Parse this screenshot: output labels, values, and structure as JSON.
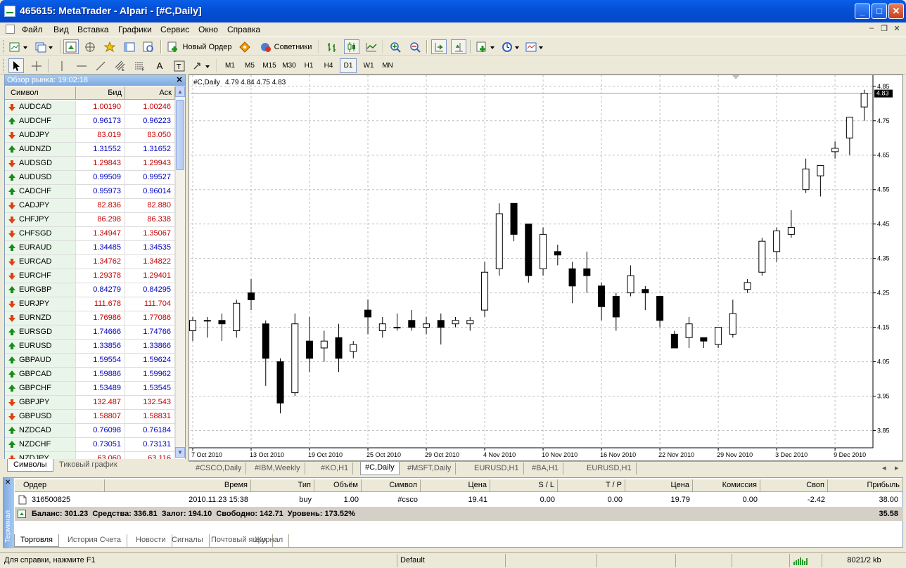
{
  "window": {
    "title": "465615: MetaTrader - Alpari - [#C,Daily]"
  },
  "menu": [
    "Файл",
    "Вид",
    "Вставка",
    "Графики",
    "Сервис",
    "Окно",
    "Справка"
  ],
  "toolbar": {
    "new_order": "Новый Ордер",
    "advisors": "Советники"
  },
  "timeframes": [
    "M1",
    "M5",
    "M15",
    "M30",
    "H1",
    "H4",
    "D1",
    "W1",
    "MN"
  ],
  "active_timeframe": "D1",
  "market_watch": {
    "title": "Обзор рынка: 19:02:18",
    "columns": {
      "symbol": "Символ",
      "bid": "Бид",
      "ask": "Аск"
    },
    "rows": [
      {
        "symbol": "AUDCAD",
        "bid": "1.00190",
        "ask": "1.00246",
        "dir": "down"
      },
      {
        "symbol": "AUDCHF",
        "bid": "0.96173",
        "ask": "0.96223",
        "dir": "up"
      },
      {
        "symbol": "AUDJPY",
        "bid": "83.019",
        "ask": "83.050",
        "dir": "down"
      },
      {
        "symbol": "AUDNZD",
        "bid": "1.31552",
        "ask": "1.31652",
        "dir": "up"
      },
      {
        "symbol": "AUDSGD",
        "bid": "1.29843",
        "ask": "1.29943",
        "dir": "down"
      },
      {
        "symbol": "AUDUSD",
        "bid": "0.99509",
        "ask": "0.99527",
        "dir": "up"
      },
      {
        "symbol": "CADCHF",
        "bid": "0.95973",
        "ask": "0.96014",
        "dir": "up"
      },
      {
        "symbol": "CADJPY",
        "bid": "82.836",
        "ask": "82.880",
        "dir": "down"
      },
      {
        "symbol": "CHFJPY",
        "bid": "86.298",
        "ask": "86.338",
        "dir": "down"
      },
      {
        "symbol": "CHFSGD",
        "bid": "1.34947",
        "ask": "1.35067",
        "dir": "down"
      },
      {
        "symbol": "EURAUD",
        "bid": "1.34485",
        "ask": "1.34535",
        "dir": "up"
      },
      {
        "symbol": "EURCAD",
        "bid": "1.34762",
        "ask": "1.34822",
        "dir": "down"
      },
      {
        "symbol": "EURCHF",
        "bid": "1.29378",
        "ask": "1.29401",
        "dir": "down"
      },
      {
        "symbol": "EURGBP",
        "bid": "0.84279",
        "ask": "0.84295",
        "dir": "up"
      },
      {
        "symbol": "EURJPY",
        "bid": "111.678",
        "ask": "111.704",
        "dir": "down"
      },
      {
        "symbol": "EURNZD",
        "bid": "1.76986",
        "ask": "1.77086",
        "dir": "down"
      },
      {
        "symbol": "EURSGD",
        "bid": "1.74666",
        "ask": "1.74766",
        "dir": "up"
      },
      {
        "symbol": "EURUSD",
        "bid": "1.33856",
        "ask": "1.33866",
        "dir": "up"
      },
      {
        "symbol": "GBPAUD",
        "bid": "1.59554",
        "ask": "1.59624",
        "dir": "up"
      },
      {
        "symbol": "GBPCAD",
        "bid": "1.59886",
        "ask": "1.59962",
        "dir": "up"
      },
      {
        "symbol": "GBPCHF",
        "bid": "1.53489",
        "ask": "1.53545",
        "dir": "up"
      },
      {
        "symbol": "GBPJPY",
        "bid": "132.487",
        "ask": "132.543",
        "dir": "down"
      },
      {
        "symbol": "GBPUSD",
        "bid": "1.58807",
        "ask": "1.58831",
        "dir": "down"
      },
      {
        "symbol": "NZDCAD",
        "bid": "0.76098",
        "ask": "0.76184",
        "dir": "up"
      },
      {
        "symbol": "NZDCHF",
        "bid": "0.73051",
        "ask": "0.73131",
        "dir": "up"
      },
      {
        "symbol": "NZDJPY",
        "bid": "63.060",
        "ask": "63.116",
        "dir": "down"
      }
    ],
    "tabs": [
      "Символы",
      "Тиковый график"
    ],
    "active_tab": "Символы"
  },
  "chart_tabs": [
    "#CSCO,Daily",
    "#IBM,Weekly",
    "#KO,H1",
    "#C,Daily",
    "#MSFT,Daily",
    "EURUSD,H1",
    "#BA,H1",
    "EURUSD,H1"
  ],
  "active_chart_tab": "#C,Daily",
  "chart_data": {
    "type": "candlestick",
    "symbol": "#C,Daily",
    "ohlc_header": "4.79 4.84 4.75 4.83",
    "current_price": "4.83",
    "ylim": [
      3.8,
      4.87
    ],
    "y_ticks": [
      "4.85",
      "4.75",
      "4.65",
      "4.55",
      "4.45",
      "4.35",
      "4.25",
      "4.15",
      "4.05",
      "3.95",
      "3.85"
    ],
    "x_ticks": [
      "7 Oct 2010",
      "13 Oct 2010",
      "19 Oct 2010",
      "25 Oct 2010",
      "29 Oct 2010",
      "4 Nov 2010",
      "10 Nov 2010",
      "16 Nov 2010",
      "22 Nov 2010",
      "29 Nov 2010",
      "3 Dec 2010",
      "9 Dec 2010"
    ],
    "grid": true,
    "candles": [
      {
        "o": 4.14,
        "h": 4.18,
        "l": 4.11,
        "c": 4.17
      },
      {
        "o": 4.17,
        "h": 4.18,
        "l": 4.12,
        "c": 4.17
      },
      {
        "o": 4.17,
        "h": 4.19,
        "l": 4.11,
        "c": 4.16
      },
      {
        "o": 4.14,
        "h": 4.23,
        "l": 4.12,
        "c": 4.22
      },
      {
        "o": 4.25,
        "h": 4.29,
        "l": 4.2,
        "c": 4.23
      },
      {
        "o": 4.16,
        "h": 4.17,
        "l": 3.98,
        "c": 4.06
      },
      {
        "o": 4.05,
        "h": 4.06,
        "l": 3.9,
        "c": 3.93
      },
      {
        "o": 3.96,
        "h": 4.19,
        "l": 3.95,
        "c": 4.16
      },
      {
        "o": 4.11,
        "h": 4.18,
        "l": 4.02,
        "c": 4.06
      },
      {
        "o": 4.09,
        "h": 4.14,
        "l": 4.05,
        "c": 4.11
      },
      {
        "o": 4.12,
        "h": 4.16,
        "l": 4.02,
        "c": 4.06
      },
      {
        "o": 4.08,
        "h": 4.11,
        "l": 4.06,
        "c": 4.1
      },
      {
        "o": 4.2,
        "h": 4.23,
        "l": 4.13,
        "c": 4.18
      },
      {
        "o": 4.14,
        "h": 4.18,
        "l": 4.12,
        "c": 4.16
      },
      {
        "o": 4.15,
        "h": 4.19,
        "l": 4.14,
        "c": 4.15
      },
      {
        "o": 4.17,
        "h": 4.2,
        "l": 4.14,
        "c": 4.15
      },
      {
        "o": 4.15,
        "h": 4.18,
        "l": 4.13,
        "c": 4.16
      },
      {
        "o": 4.17,
        "h": 4.19,
        "l": 4.1,
        "c": 4.15
      },
      {
        "o": 4.16,
        "h": 4.18,
        "l": 4.15,
        "c": 4.17
      },
      {
        "o": 4.16,
        "h": 4.18,
        "l": 4.14,
        "c": 4.17
      },
      {
        "o": 4.2,
        "h": 4.34,
        "l": 4.18,
        "c": 4.31
      },
      {
        "o": 4.32,
        "h": 4.51,
        "l": 4.3,
        "c": 4.48
      },
      {
        "o": 4.51,
        "h": 4.51,
        "l": 4.4,
        "c": 4.42
      },
      {
        "o": 4.45,
        "h": 4.45,
        "l": 4.28,
        "c": 4.3
      },
      {
        "o": 4.32,
        "h": 4.44,
        "l": 4.3,
        "c": 4.42
      },
      {
        "o": 4.37,
        "h": 4.39,
        "l": 4.33,
        "c": 4.36
      },
      {
        "o": 4.32,
        "h": 4.34,
        "l": 4.22,
        "c": 4.27
      },
      {
        "o": 4.32,
        "h": 4.37,
        "l": 4.25,
        "c": 4.3
      },
      {
        "o": 4.27,
        "h": 4.28,
        "l": 4.17,
        "c": 4.21
      },
      {
        "o": 4.24,
        "h": 4.25,
        "l": 4.14,
        "c": 4.18
      },
      {
        "o": 4.25,
        "h": 4.33,
        "l": 4.24,
        "c": 4.3
      },
      {
        "o": 4.26,
        "h": 4.27,
        "l": 4.2,
        "c": 4.25
      },
      {
        "o": 4.24,
        "h": 4.24,
        "l": 4.15,
        "c": 4.17
      },
      {
        "o": 4.13,
        "h": 4.14,
        "l": 4.09,
        "c": 4.09
      },
      {
        "o": 4.12,
        "h": 4.18,
        "l": 4.09,
        "c": 4.16
      },
      {
        "o": 4.12,
        "h": 4.12,
        "l": 4.09,
        "c": 4.11
      },
      {
        "o": 4.1,
        "h": 4.15,
        "l": 4.09,
        "c": 4.15
      },
      {
        "o": 4.13,
        "h": 4.23,
        "l": 4.12,
        "c": 4.19
      },
      {
        "o": 4.26,
        "h": 4.29,
        "l": 4.25,
        "c": 4.28
      },
      {
        "o": 4.31,
        "h": 4.41,
        "l": 4.3,
        "c": 4.4
      },
      {
        "o": 4.37,
        "h": 4.44,
        "l": 4.34,
        "c": 4.43
      },
      {
        "o": 4.42,
        "h": 4.49,
        "l": 4.41,
        "c": 4.44
      },
      {
        "o": 4.55,
        "h": 4.64,
        "l": 4.54,
        "c": 4.61
      },
      {
        "o": 4.59,
        "h": 4.62,
        "l": 4.53,
        "c": 4.62
      },
      {
        "o": 4.66,
        "h": 4.69,
        "l": 4.64,
        "c": 4.67
      },
      {
        "o": 4.7,
        "h": 4.76,
        "l": 4.65,
        "c": 4.76
      },
      {
        "o": 4.79,
        "h": 4.84,
        "l": 4.75,
        "c": 4.83
      }
    ]
  },
  "terminal": {
    "side_label": "Терминал",
    "columns": [
      "Ордер",
      "Время",
      "Тип",
      "Объём",
      "Символ",
      "Цена",
      "S / L",
      "T / P",
      "Цена",
      "Комиссия",
      "Своп",
      "Прибыль"
    ],
    "order": {
      "id": "316500825",
      "time": "2010.11.23 15:38",
      "type": "buy",
      "volume": "1.00",
      "symbol": "#csco",
      "price": "19.41",
      "sl": "0.00",
      "tp": "0.00",
      "cur_price": "19.79",
      "commission": "0.00",
      "swap": "-2.42",
      "profit": "38.00"
    },
    "balance_line": "Баланс: 301.23  Средства: 336.81  Залог: 194.10  Свободно: 142.71  Уровень: 173.52%",
    "total_profit": "35.58",
    "tabs": [
      "Торговля",
      "История Счета",
      "Новости",
      "Сигналы",
      "Почтовый ящик",
      "Журнал"
    ],
    "active_tab": "Торговля"
  },
  "status": {
    "help": "Для справки, нажмите F1",
    "profile": "Default",
    "traffic": "8021/2 kb"
  },
  "colors": {
    "bid_up": "#0000c0",
    "bid_down": "#c00000",
    "title_bar": "#0550d6"
  }
}
